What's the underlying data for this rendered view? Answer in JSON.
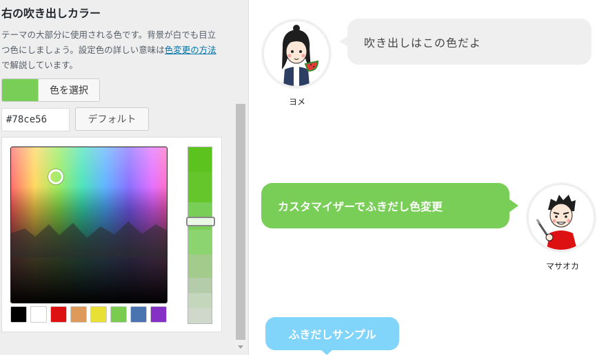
{
  "panel": {
    "title": "右の吹き出しカラー",
    "description_before_link": "テーマの大部分に使用される色です。背景が白でも目立つ色にしましょう。設定色の詳しい意味は",
    "description_link": "色変更の方法",
    "description_after_link": "で解説しています。",
    "select_color_label": "色を選択",
    "hex_value": "#78ce56",
    "default_label": "デフォルト",
    "current_color": "#78ce56",
    "palette": [
      {
        "name": "black",
        "color": "#000000"
      },
      {
        "name": "white",
        "color": "#ffffff"
      },
      {
        "name": "red",
        "color": "#dd1111"
      },
      {
        "name": "orange",
        "color": "#dd9a5a"
      },
      {
        "name": "yellow",
        "color": "#e8e034"
      },
      {
        "name": "green",
        "color": "#7acc50"
      },
      {
        "name": "blue",
        "color": "#4a74b0"
      },
      {
        "name": "purple",
        "color": "#8630c6"
      }
    ]
  },
  "preview": {
    "bubble1_text": "吹き出しはこの色だよ",
    "avatar1_name": "ヨメ",
    "bubble2_text": "カスタマイザーでふきだし色変更",
    "avatar2_name": "マサオカ",
    "bubble3_text": "ふきだしサンプル",
    "colors": {
      "gray_bubble": "#efefef",
      "green_bubble": "#78ce56",
      "blue_bubble": "#81d4fa"
    }
  }
}
